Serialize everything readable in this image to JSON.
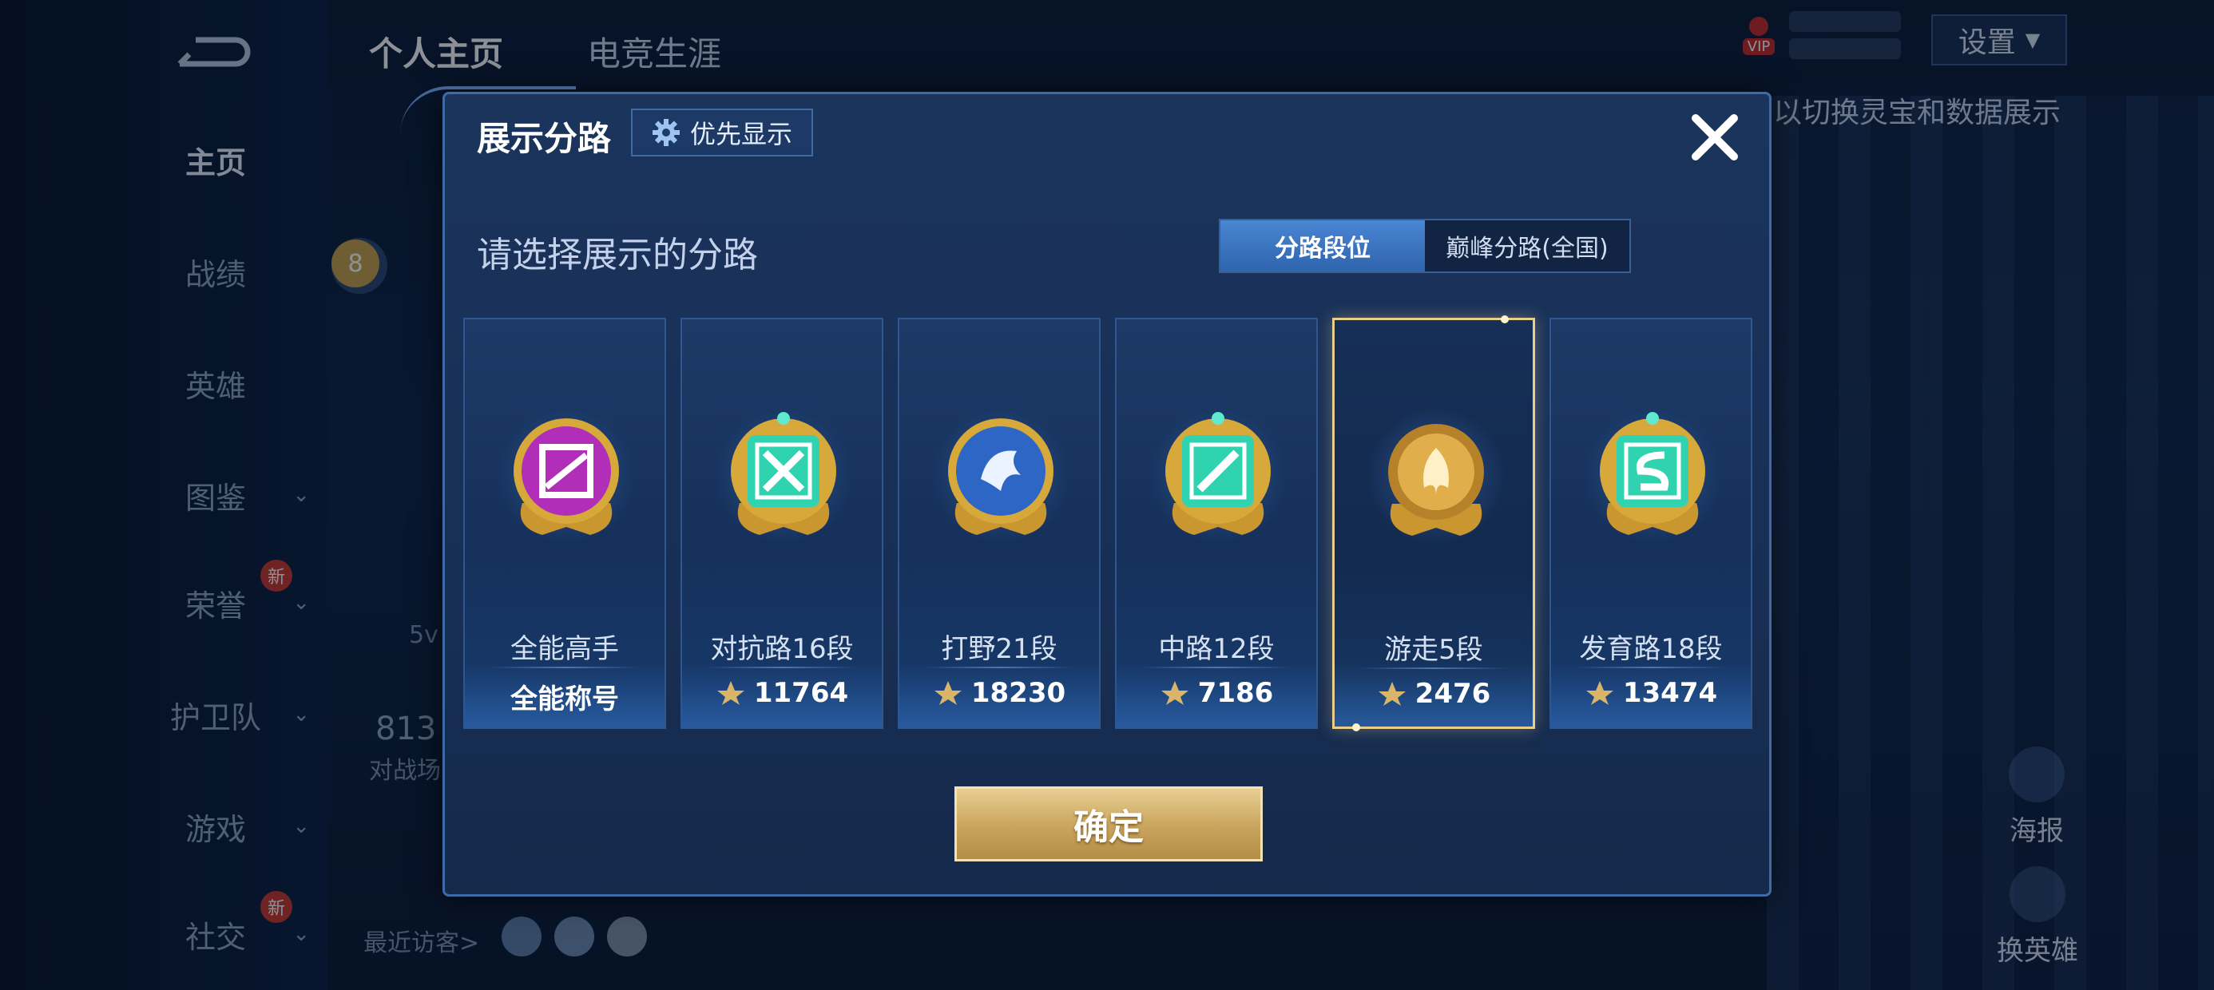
{
  "background": {
    "top_tabs": [
      "个人主页",
      "电竞生涯"
    ],
    "nav": [
      {
        "label": "主页",
        "active": true,
        "chevron": false,
        "new": false
      },
      {
        "label": "战绩",
        "active": false,
        "chevron": false,
        "new": false
      },
      {
        "label": "英雄",
        "active": false,
        "chevron": false,
        "new": false
      },
      {
        "label": "图鉴",
        "active": false,
        "chevron": true,
        "new": false
      },
      {
        "label": "荣誉",
        "active": false,
        "chevron": true,
        "new": true
      },
      {
        "label": "护卫队",
        "active": false,
        "chevron": true,
        "new": false
      },
      {
        "label": "游戏",
        "active": false,
        "chevron": true,
        "new": false
      },
      {
        "label": "社交",
        "active": false,
        "chevron": true,
        "new": true
      }
    ],
    "new_badge": "新",
    "settings_label": "设置",
    "vip_label": "VIP",
    "hint_text": "以切换灵宝和数据展示",
    "poster_label": "海报",
    "switch_hero_label": "换英雄",
    "recent_visitors": "最近访客>",
    "level_badge": "8",
    "partial_text_5v": "5v",
    "partial_number": "813",
    "partial_battle": "对战场"
  },
  "modal": {
    "title": "展示分路",
    "priority_button": "优先显示",
    "subtitle": "请选择展示的分路",
    "segment": {
      "options": [
        "分路段位",
        "巅峰分路(全国)"
      ],
      "active_index": 0
    },
    "cards": [
      {
        "name": "全能高手",
        "value": "全能称号",
        "has_icon": false,
        "emblem": "purple-allround-emblem",
        "selected": false
      },
      {
        "name": "对抗路16段",
        "value": "11764",
        "has_icon": true,
        "emblem": "teal-clash-lane-emblem",
        "selected": false
      },
      {
        "name": "打野21段",
        "value": "18230",
        "has_icon": true,
        "emblem": "blue-dragon-jungle-emblem",
        "selected": false
      },
      {
        "name": "中路12段",
        "value": "7186",
        "has_icon": true,
        "emblem": "teal-mid-lane-emblem",
        "selected": false
      },
      {
        "name": "游走5段",
        "value": "2476",
        "has_icon": true,
        "emblem": "gold-roam-emblem",
        "selected": true
      },
      {
        "name": "发育路18段",
        "value": "13474",
        "has_icon": true,
        "emblem": "teal-farm-lane-emblem",
        "selected": false
      }
    ],
    "confirm_button": "确定"
  },
  "colors": {
    "accent_gold": "#e9cf8e",
    "segment_active": "#3f78c6",
    "modal_bg": "#1b345c",
    "teal_emblem": "#2fd3b0",
    "purple_emblem": "#b431b8"
  }
}
